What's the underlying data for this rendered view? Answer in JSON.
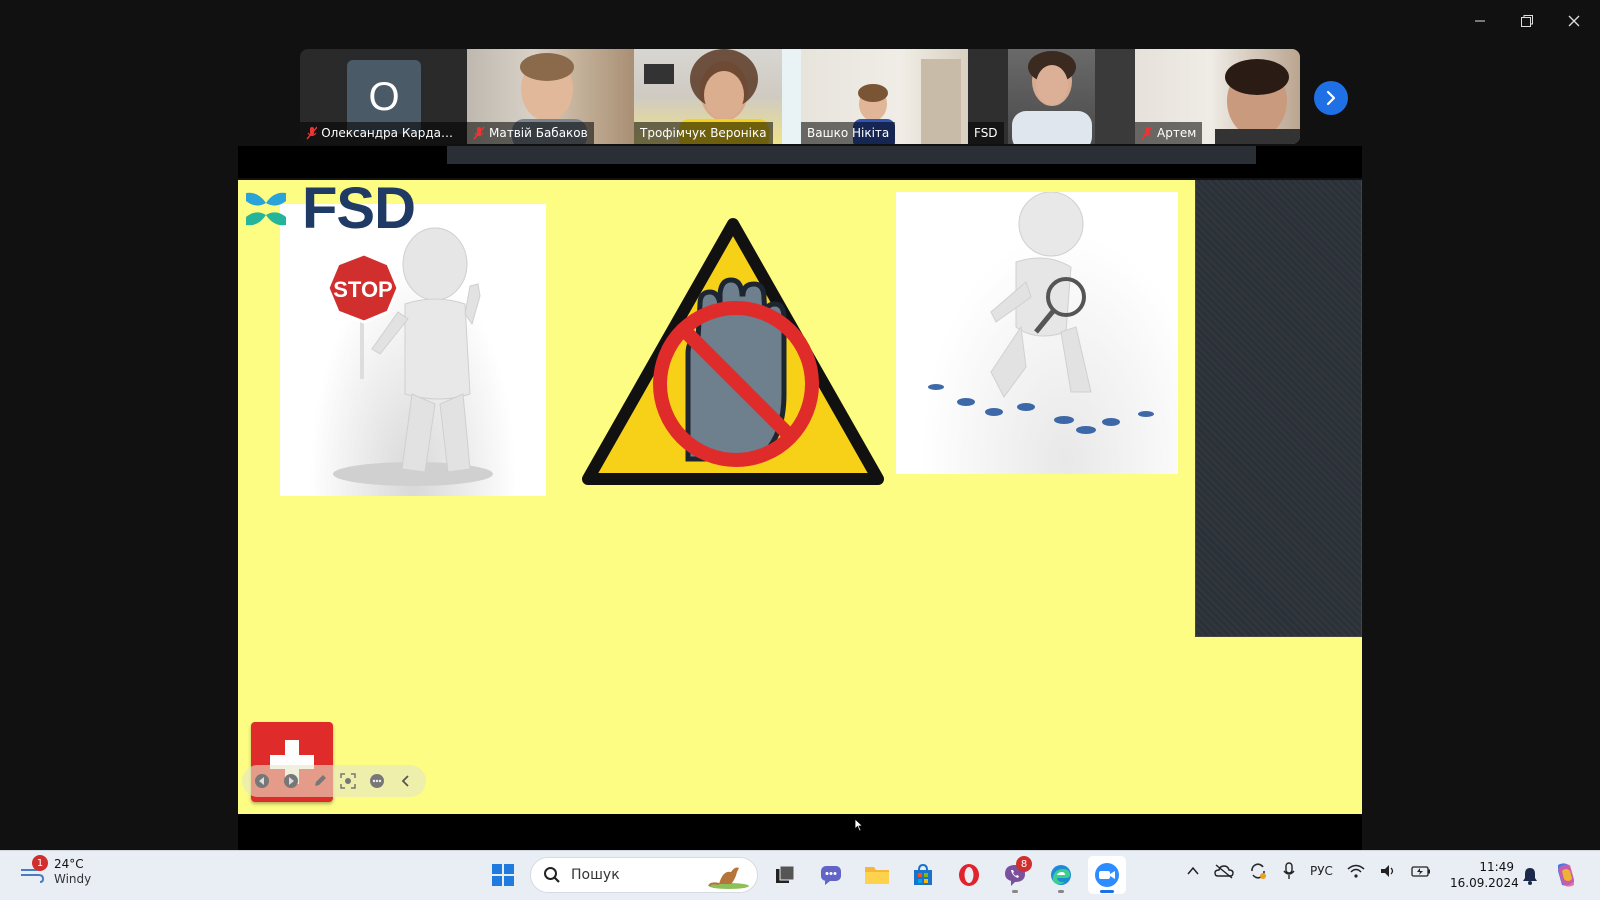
{
  "window": {
    "controls": [
      "minimize-icon",
      "restore-icon",
      "close-icon"
    ]
  },
  "participants": [
    {
      "name": "Олександра Кардашо...",
      "muted": true,
      "avatar_letter": "О",
      "video": false
    },
    {
      "name": "Матвій Бабаков",
      "muted": true,
      "video": true
    },
    {
      "name": "Трофімчук Вероніка",
      "muted": false,
      "video": true
    },
    {
      "name": "Вашко Нікіта",
      "muted": false,
      "video": true
    },
    {
      "name": "FSD",
      "muted": false,
      "video": true,
      "active_speaker": true
    },
    {
      "name": "Артем",
      "muted": true,
      "video": true
    }
  ],
  "slide": {
    "logo_text": "FSD",
    "stop_sign_text": "STOP",
    "colors": {
      "background": "#fdfd83",
      "logo": "#1f3a64",
      "warning": "#f7d117",
      "prohibit": "#e02b2b"
    }
  },
  "taskbar": {
    "weather": {
      "alert_count": "1",
      "temperature": "24°C",
      "condition": "Windy"
    },
    "search_placeholder": "Пошук",
    "viber_badge": "8",
    "language": "РУС",
    "time": "11:49",
    "date": "16.09.2024"
  }
}
